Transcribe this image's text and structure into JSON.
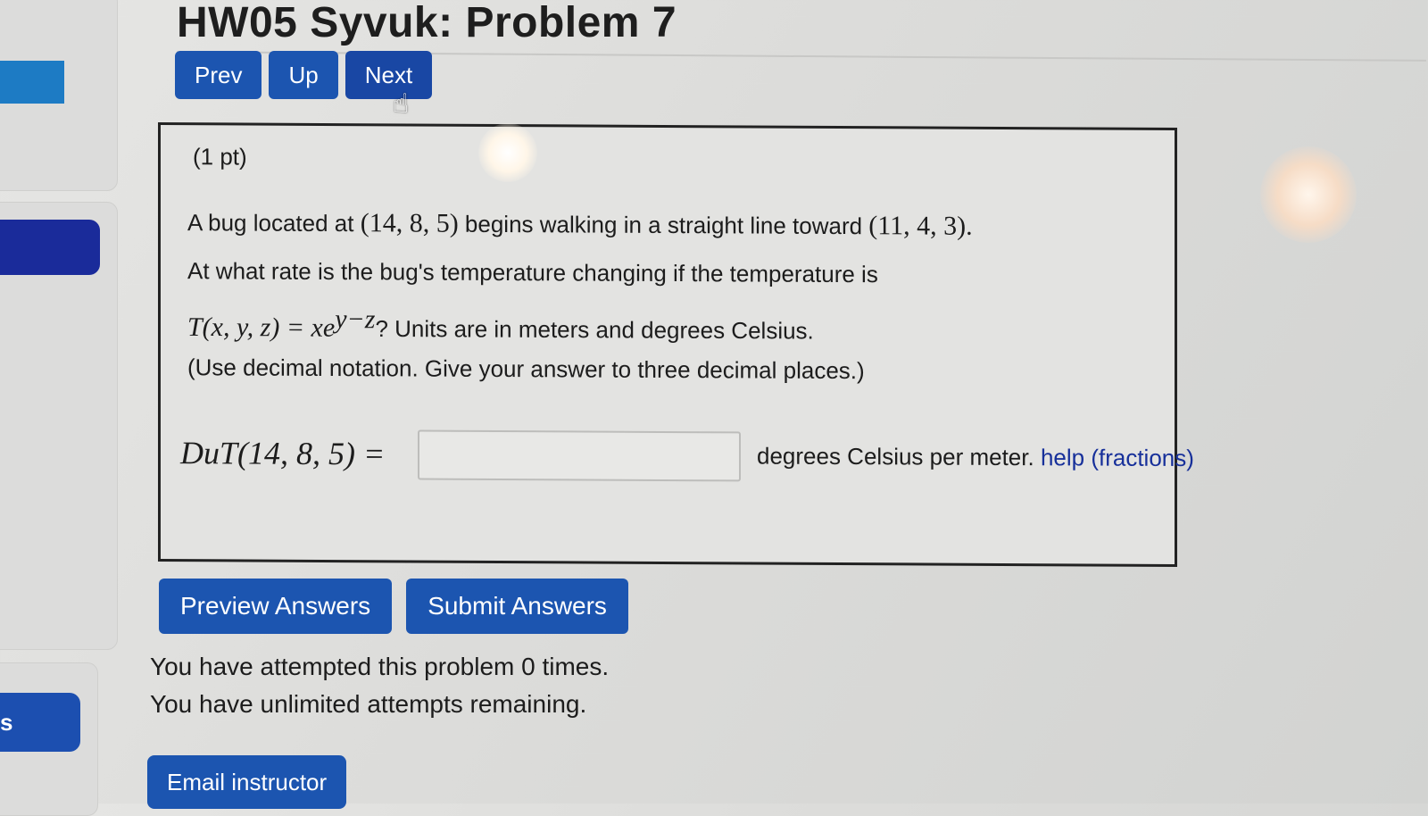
{
  "page": {
    "title": "HW05 Syvuk: Problem 7"
  },
  "nav": {
    "prev_label": "Prev",
    "up_label": "Up",
    "next_label": "Next"
  },
  "sidebar": {
    "bottom_item_label": "s"
  },
  "problem": {
    "points": "(1 pt)",
    "line1_pre": "A bug located at ",
    "start_point": "(14,  8,  5)",
    "line1_mid": " begins walking in a straight line toward ",
    "end_point": "(11,  4,  3).",
    "line2": "At what rate is the bug's temperature changing if the temperature is",
    "func_lhs": "T(x,  y,  z) = xe",
    "func_exp": "y−z",
    "line3_post": "? Units are in meters and degrees Celsius.",
    "line4": "(Use decimal notation. Give your answer to three decimal places.)",
    "answer_label": "DuT(14, 8, 5) =",
    "answer_value": "",
    "units_text": "degrees Celsius per meter.",
    "help_link": "help (fractions)"
  },
  "actions": {
    "preview_label": "Preview Answers",
    "submit_label": "Submit Answers"
  },
  "status": {
    "attempts": "You have attempted this problem 0 times.",
    "remaining": "You have unlimited attempts remaining."
  },
  "footer": {
    "email_label": "Email instructor"
  },
  "colors": {
    "button_blue": "#1c55b0",
    "link_blue": "#17309a",
    "sidebar_navy": "#1a2b9a"
  }
}
